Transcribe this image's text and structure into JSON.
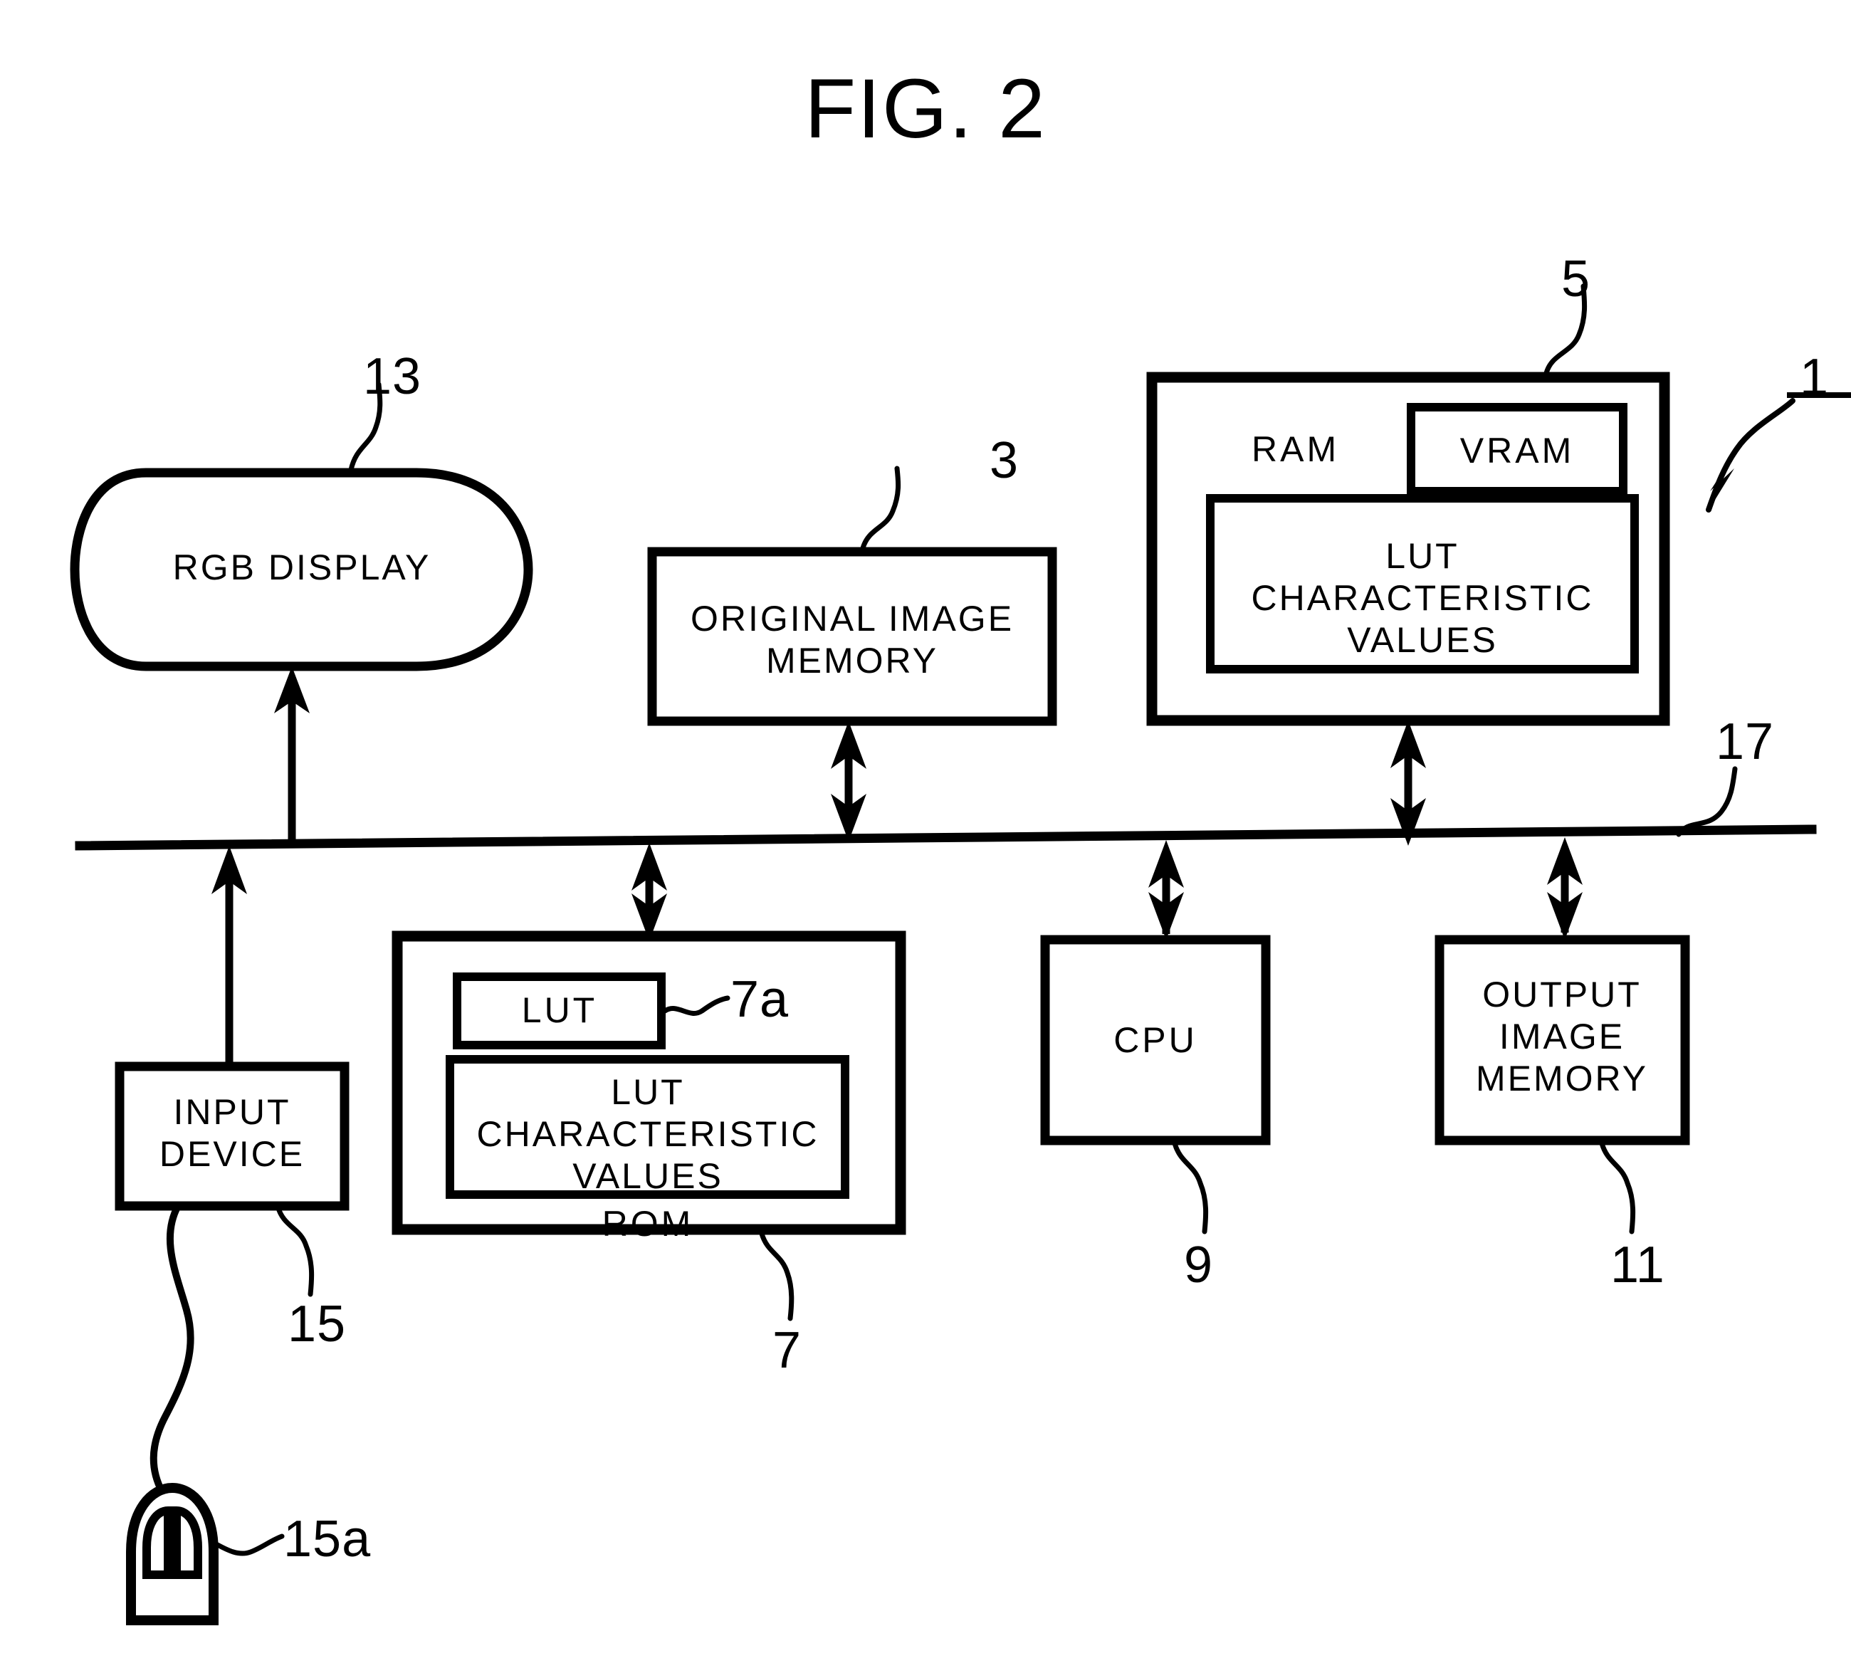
{
  "figure": {
    "title": "FIG. 2",
    "domain": "patent-block-diagram"
  },
  "blocks": {
    "rgb_display": {
      "label": "RGB DISPLAY",
      "ref": "13"
    },
    "original_image_memory": {
      "label": "ORIGINAL IMAGE\nMEMORY",
      "ref": "3"
    },
    "ram": {
      "label": "RAM",
      "ref": "5"
    },
    "vram": {
      "label": "VRAM"
    },
    "ram_lut_values": {
      "label": "LUT\nCHARACTERISTIC\nVALUES"
    },
    "rom": {
      "label": "ROM",
      "ref": "7"
    },
    "rom_lut": {
      "label": "LUT",
      "ref": "7a"
    },
    "rom_lut_values": {
      "label": "LUT\nCHARACTERISTIC\nVALUES"
    },
    "cpu": {
      "label": "CPU",
      "ref": "9"
    },
    "output_image_memory": {
      "label": "OUTPUT\nIMAGE\nMEMORY",
      "ref": "11"
    },
    "input_device": {
      "label": "INPUT\nDEVICE",
      "ref": "15"
    },
    "mouse": {
      "label": "",
      "ref": "15a"
    },
    "bus": {
      "label": "",
      "ref": "17"
    },
    "system": {
      "label": "",
      "ref": "1"
    }
  },
  "reference_numerals": {
    "system": "1",
    "original_image_memory": "3",
    "ram": "5",
    "rom": "7",
    "rom_lut": "7a",
    "cpu": "9",
    "output_image_memory": "11",
    "rgb_display": "13",
    "input_device": "15",
    "mouse": "15a",
    "bus": "17"
  },
  "colors": {
    "ink": "#000000",
    "paper": "#ffffff"
  }
}
